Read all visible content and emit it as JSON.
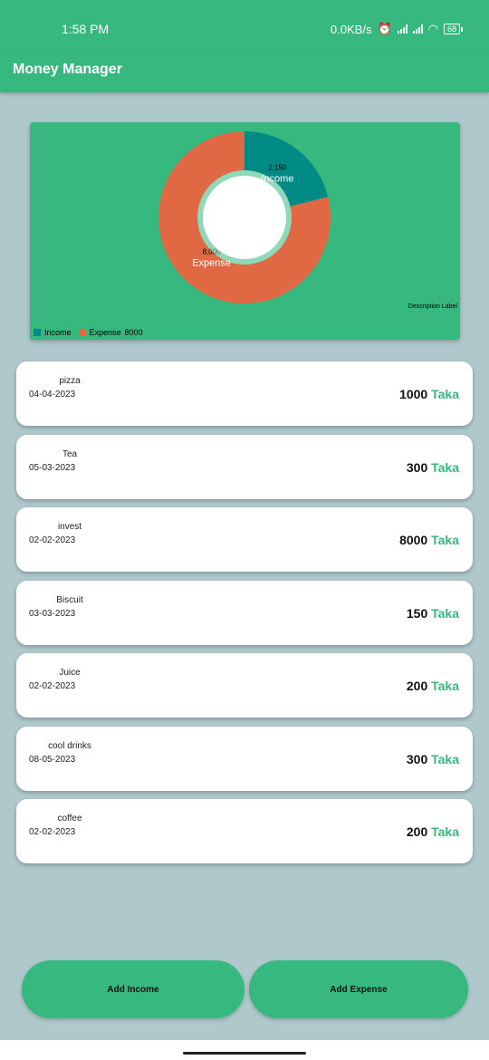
{
  "status_bar": {
    "time": "1:58 PM",
    "speed": "0.0KB/s",
    "battery": "68"
  },
  "app": {
    "title": "Money Manager"
  },
  "chart_data": {
    "type": "pie",
    "series": [
      {
        "name": "Income",
        "value": 2150,
        "label": "2,150",
        "color": "#008b86"
      },
      {
        "name": "Expense",
        "value": 8000,
        "label": "8,000",
        "color": "#e06944"
      }
    ],
    "description": "Description Label",
    "legend": {
      "items": [
        "Income",
        "Expense"
      ],
      "extra": "8000",
      "placement": "bottom-left"
    }
  },
  "transactions": [
    {
      "name": "pizza",
      "date": "04-04-2023",
      "amount": "1000",
      "currency": "Taka"
    },
    {
      "name": "Tea",
      "date": "05-03-2023",
      "amount": "300",
      "currency": "Taka"
    },
    {
      "name": "invest",
      "date": "02-02-2023",
      "amount": "8000",
      "currency": "Taka"
    },
    {
      "name": "Biscuit",
      "date": "03-03-2023",
      "amount": "150",
      "currency": "Taka"
    },
    {
      "name": "Juice",
      "date": "02-02-2023",
      "amount": "200",
      "currency": "Taka"
    },
    {
      "name": "cool drinks",
      "date": "08-05-2023",
      "amount": "300",
      "currency": "Taka"
    },
    {
      "name": "coffee",
      "date": "02-02-2023",
      "amount": "200",
      "currency": "Taka"
    }
  ],
  "buttons": {
    "add_income": "Add Income",
    "add_expense": "Add Expense"
  }
}
